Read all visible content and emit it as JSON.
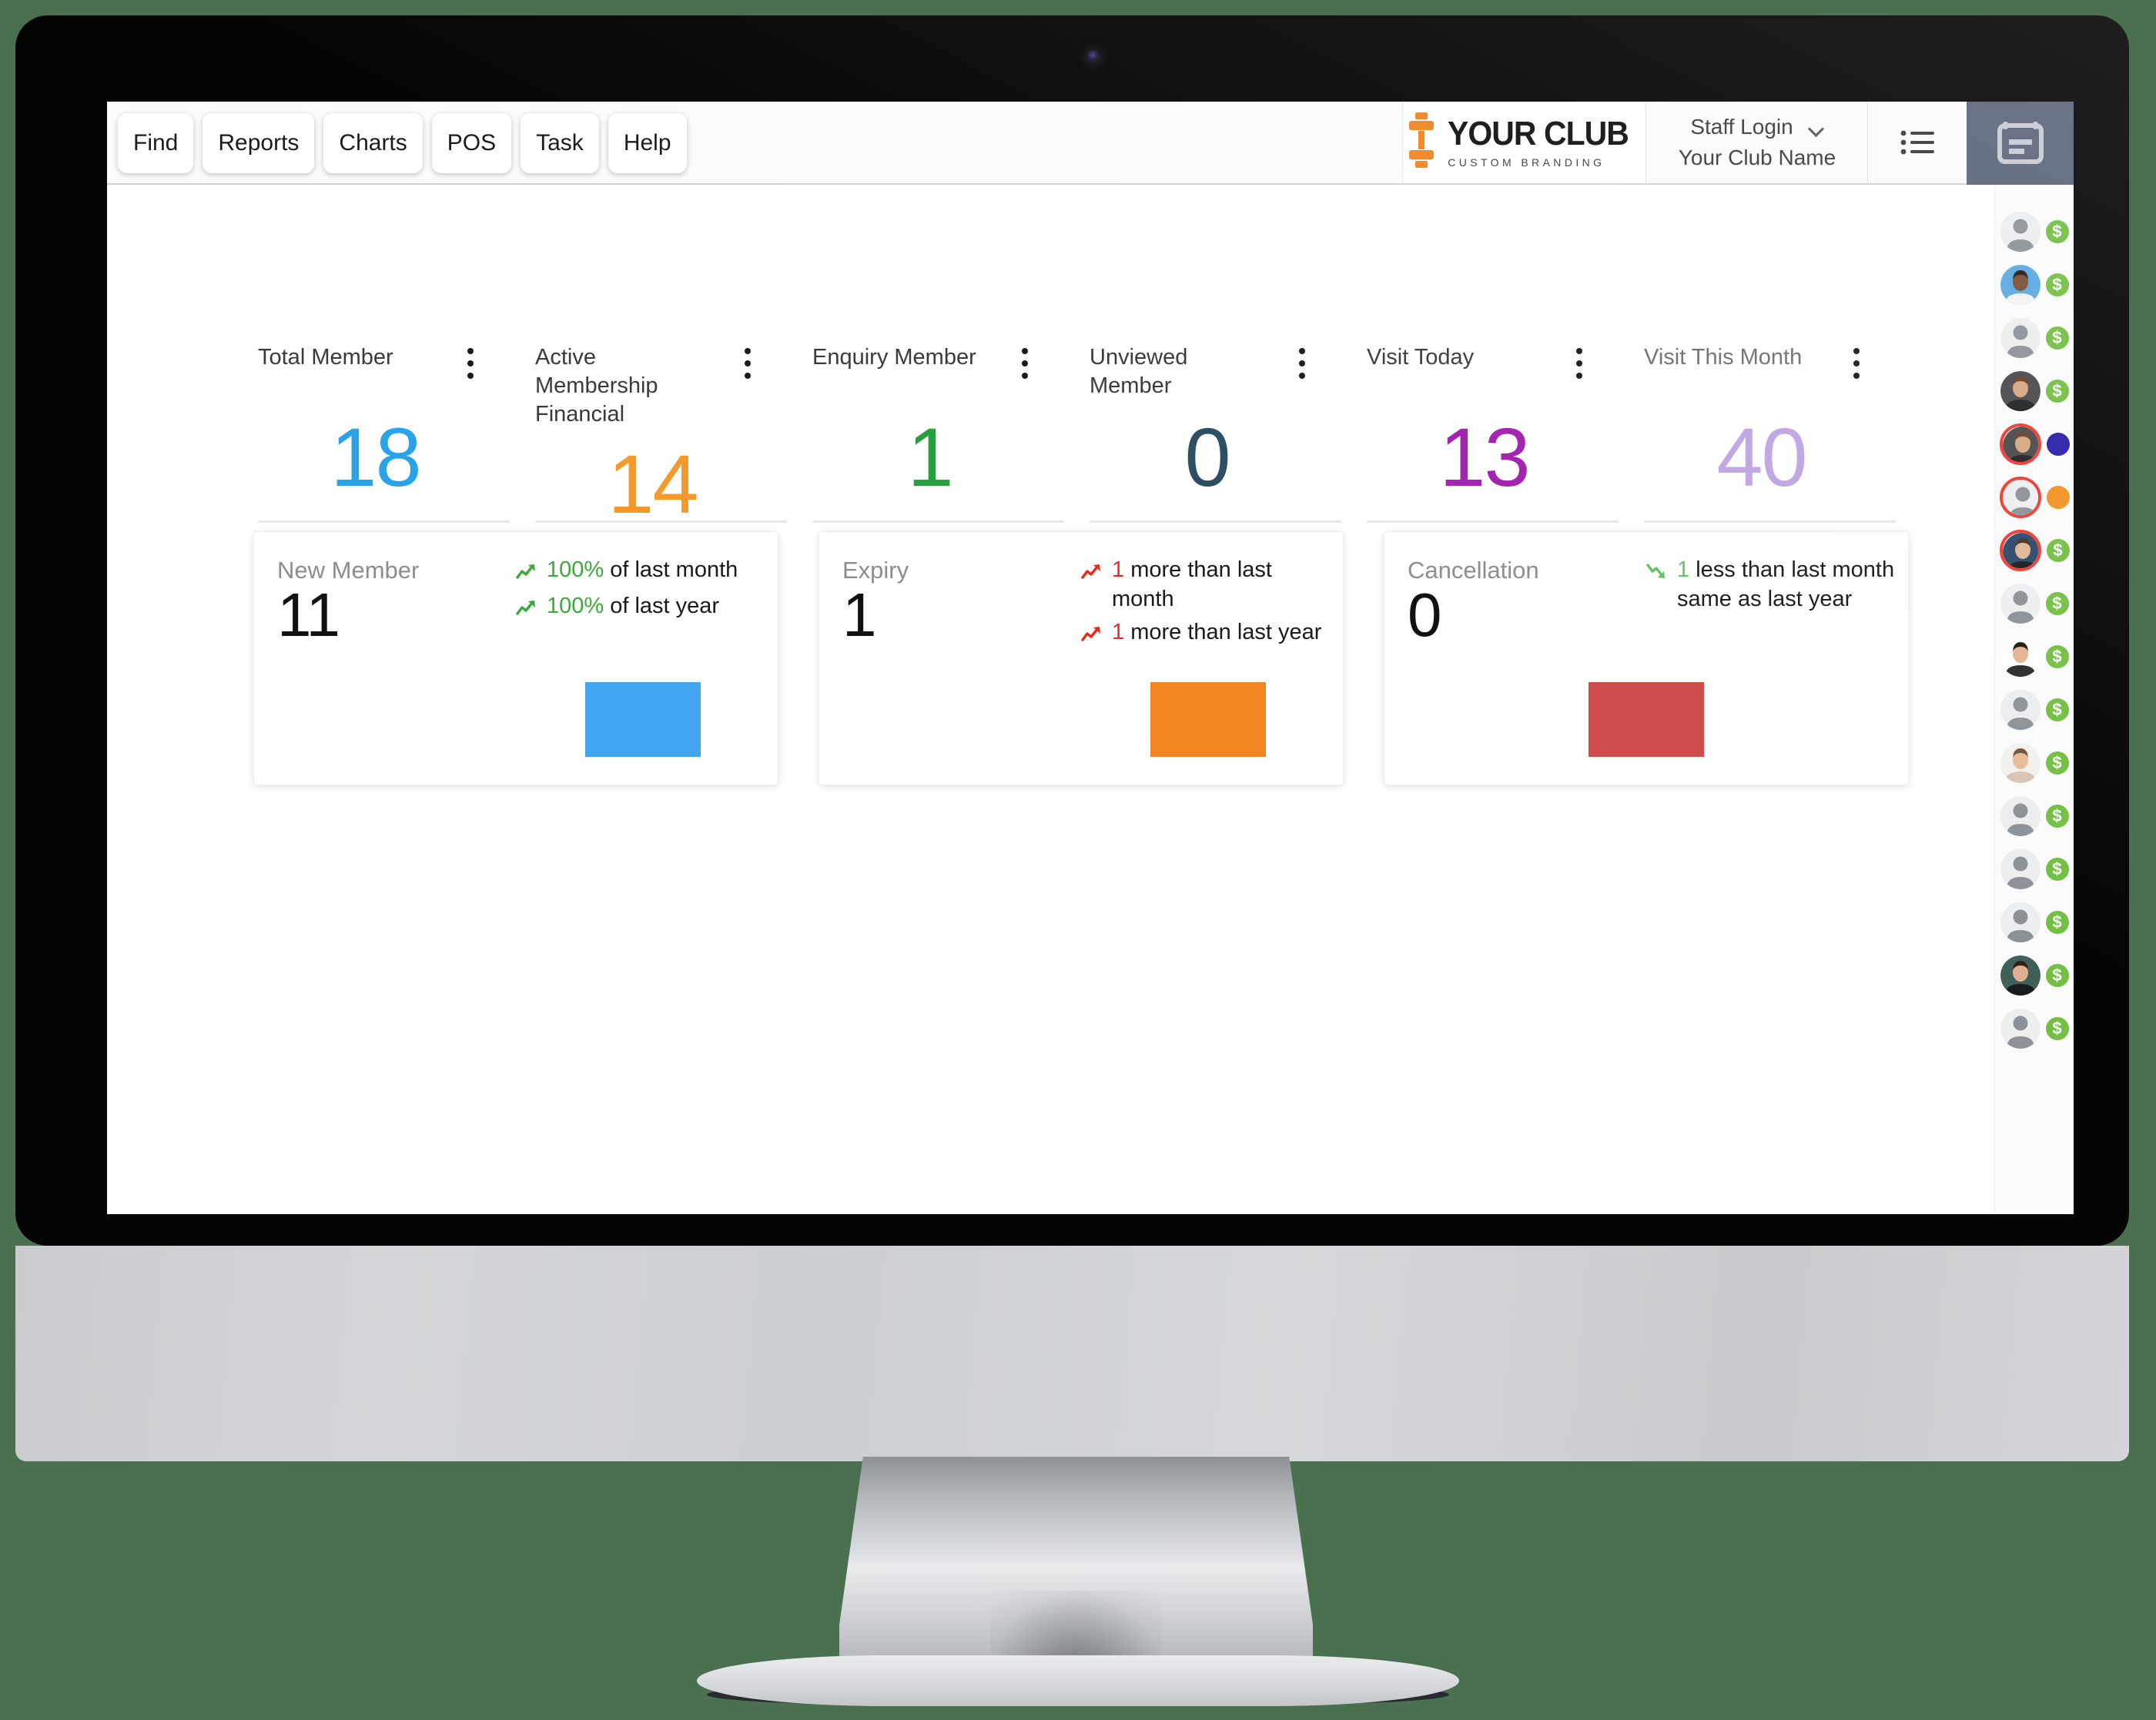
{
  "theme": {
    "background": "#4a7050",
    "accent_orange": "#f08522",
    "bezel": "#050505",
    "calendar_tile": "#5c667a"
  },
  "topbar": {
    "nav_buttons": [
      {
        "label": "Find",
        "name": "find"
      },
      {
        "label": "Reports",
        "name": "reports"
      },
      {
        "label": "Charts",
        "name": "charts"
      },
      {
        "label": "POS",
        "name": "pos"
      },
      {
        "label": "Task",
        "name": "task"
      },
      {
        "label": "Help",
        "name": "help"
      }
    ],
    "logo": {
      "title": "YOUR CLUB",
      "subtitle": "CUSTOM BRANDING",
      "icon": "dumbbell-icon",
      "color": "#f08522"
    },
    "staff": {
      "login_label": "Staff Login",
      "club_name": "Your Club Name",
      "chevron": "chevron-down-icon"
    },
    "list_icon": "list-icon",
    "calendar_icon": "calendar-icon"
  },
  "kpis": [
    {
      "label": "Total Member",
      "value": "18",
      "color": "#29a3e8",
      "muted": false
    },
    {
      "label": "Active Membership Financial",
      "value": "14",
      "color": "#f5992b",
      "muted": false
    },
    {
      "label": "Enquiry Member",
      "value": "1",
      "color": "#27a03f",
      "muted": false
    },
    {
      "label": "Unviewed Member",
      "value": "0",
      "color": "#2c4e62",
      "muted": false
    },
    {
      "label": "Visit Today",
      "value": "13",
      "color": "#a21fb0",
      "muted": false
    },
    {
      "label": "Visit This Month",
      "value": "40",
      "color": "#bfa5e4",
      "muted": true
    }
  ],
  "cards": [
    {
      "label": "New Member",
      "value": "11",
      "swatch_color": "#42a5ef",
      "swatch_align": "right",
      "trends": [
        {
          "icon": "trend-up-icon",
          "icon_color": "#3aaa3a",
          "number": "100%",
          "number_color": "#3aaa3a",
          "text": " of last month"
        },
        {
          "icon": "trend-up-icon",
          "icon_color": "#3aaa3a",
          "number": "100%",
          "number_color": "#3aaa3a",
          "text": " of last year"
        }
      ]
    },
    {
      "label": "Expiry",
      "value": "1",
      "swatch_color": "#f08522",
      "swatch_align": "right",
      "trends": [
        {
          "icon": "trend-up-icon",
          "icon_color": "#ea2a1f",
          "number": "1",
          "number_color": "#ea2a1f",
          "text": " more than last month"
        },
        {
          "icon": "trend-up-icon",
          "icon_color": "#ea2a1f",
          "number": "1",
          "number_color": "#ea2a1f",
          "text": " more than last year"
        }
      ]
    },
    {
      "label": "Cancellation",
      "value": "0",
      "swatch_color": "#cd4b4b",
      "swatch_align": "center",
      "trends": [
        {
          "icon": "trend-down-icon",
          "icon_color": "#5dc45d",
          "number": "1",
          "number_color": "#5dc45d",
          "text": " less than last month same as last year"
        }
      ]
    }
  ],
  "rail": {
    "items": [
      {
        "avatar": "placeholder",
        "flagged": false,
        "badge": "dollar",
        "badge_color": "#73bf44",
        "badge_label": "$"
      },
      {
        "avatar": "photo-man-beard",
        "flagged": false,
        "badge": "dollar",
        "badge_color": "#73bf44",
        "badge_label": "$"
      },
      {
        "avatar": "placeholder",
        "flagged": false,
        "badge": "dollar",
        "badge_color": "#73bf44",
        "badge_label": "$"
      },
      {
        "avatar": "photo-woman-curly",
        "flagged": false,
        "badge": "dollar",
        "badge_color": "#73bf44",
        "badge_label": "$"
      },
      {
        "avatar": "photo-woman-curly",
        "flagged": true,
        "badge": "dot",
        "badge_color": "#2a1fa8",
        "badge_label": ""
      },
      {
        "avatar": "placeholder",
        "flagged": true,
        "badge": "dot",
        "badge_color": "#f09224",
        "badge_label": ""
      },
      {
        "avatar": "photo-woman-dark",
        "flagged": true,
        "badge": "dollar",
        "badge_color": "#73bf44",
        "badge_label": "$"
      },
      {
        "avatar": "placeholder",
        "flagged": false,
        "badge": "dollar",
        "badge_color": "#73bf44",
        "badge_label": "$"
      },
      {
        "avatar": "photo-man-young",
        "flagged": false,
        "badge": "dollar",
        "badge_color": "#73bf44",
        "badge_label": "$"
      },
      {
        "avatar": "placeholder",
        "flagged": false,
        "badge": "dollar",
        "badge_color": "#73bf44",
        "badge_label": "$"
      },
      {
        "avatar": "photo-woman-short",
        "flagged": false,
        "badge": "dollar",
        "badge_color": "#73bf44",
        "badge_label": "$"
      },
      {
        "avatar": "placeholder",
        "flagged": false,
        "badge": "dollar",
        "badge_color": "#73bf44",
        "badge_label": "$"
      },
      {
        "avatar": "placeholder",
        "flagged": false,
        "badge": "dollar",
        "badge_color": "#73bf44",
        "badge_label": "$"
      },
      {
        "avatar": "placeholder",
        "flagged": false,
        "badge": "dollar",
        "badge_color": "#73bf44",
        "badge_label": "$"
      },
      {
        "avatar": "photo-woman-long",
        "flagged": false,
        "badge": "dollar",
        "badge_color": "#73bf44",
        "badge_label": "$"
      },
      {
        "avatar": "placeholder",
        "flagged": false,
        "badge": "dollar",
        "badge_color": "#73bf44",
        "badge_label": "$"
      }
    ]
  }
}
